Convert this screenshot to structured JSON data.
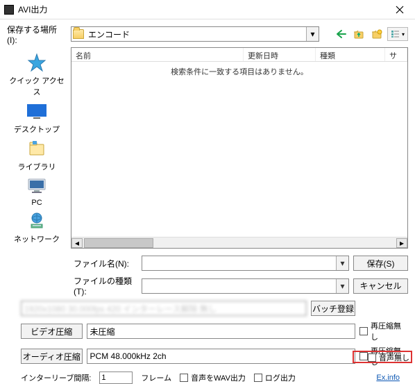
{
  "window": {
    "title": "AVI出力"
  },
  "save_in": {
    "label": "保存する場所(I):",
    "folder": "エンコード"
  },
  "places": {
    "quick_access": "クイック アクセス",
    "desktop": "デスクトップ",
    "libraries": "ライブラリ",
    "pc": "PC",
    "network": "ネットワーク"
  },
  "filelist": {
    "columns": {
      "name": "名前",
      "modified": "更新日時",
      "type": "種類",
      "size": "サ"
    },
    "empty": "検索条件に一致する項目はありません。"
  },
  "fields": {
    "filename_label": "ファイル名(N):",
    "filename_value": "",
    "filetype_label": "ファイルの種類(T):",
    "filetype_value": ""
  },
  "buttons": {
    "save": "保存(S)",
    "cancel": "キャンセル",
    "batch": "バッチ登録"
  },
  "dim_text": "1920x1080  30.000fps  420  インターレース解除  無し",
  "compress": {
    "video_btn": "ビデオ圧縮",
    "video_val": "未圧縮",
    "audio_btn": "オーディオ圧縮",
    "audio_val": "PCM 48.000kHz 2ch",
    "nocompress": "再圧縮無し",
    "noaudio": "音声無し"
  },
  "footer": {
    "interleave_label": "インターリーブ間隔:",
    "interleave_value": "1",
    "interleave_unit": "フレーム",
    "wav_out": "音声をWAV出力",
    "log_out": "ログ出力",
    "exinfo": "Ex.info"
  }
}
